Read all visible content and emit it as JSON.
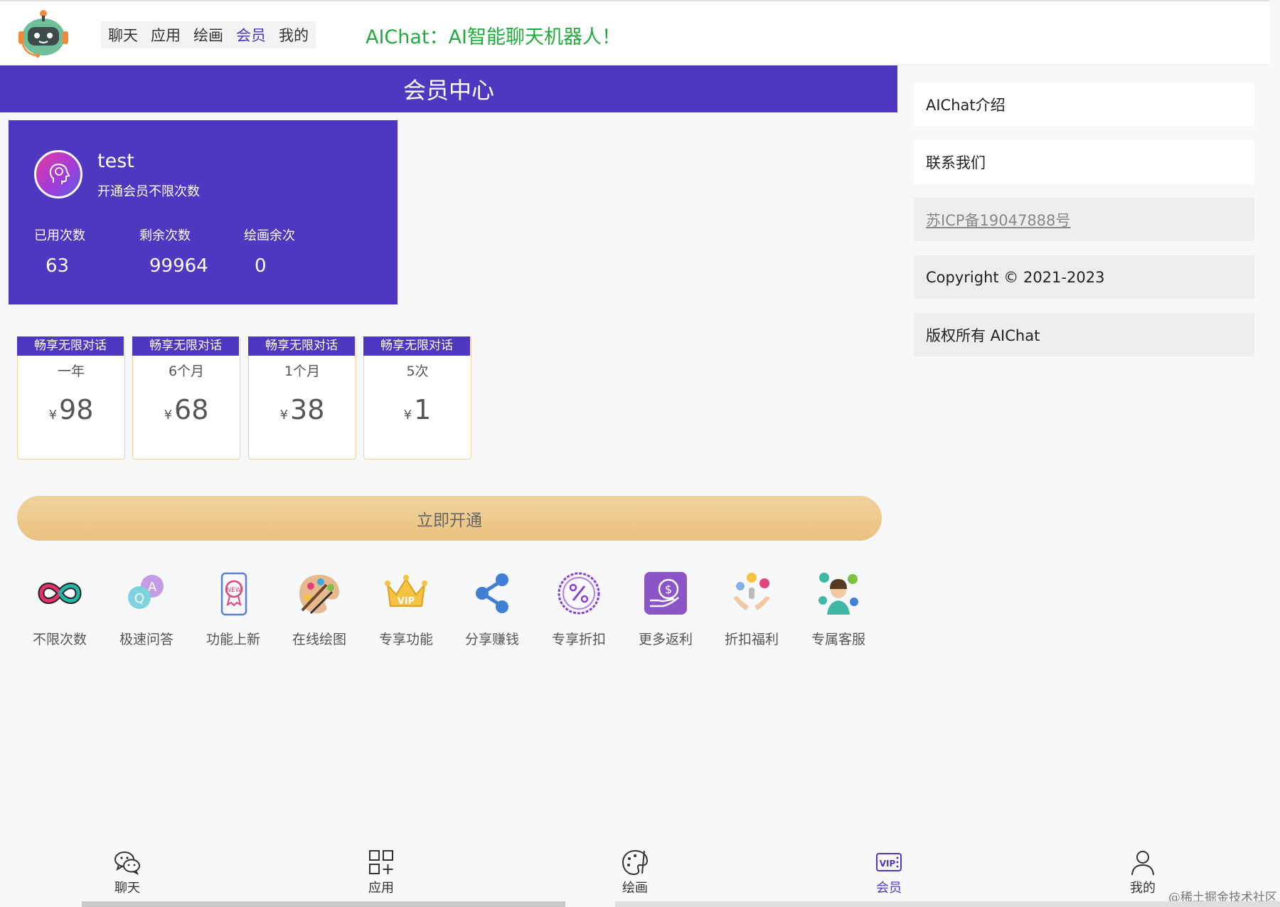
{
  "header": {
    "nav": [
      "聊天",
      "应用",
      "绘画",
      "会员",
      "我的"
    ],
    "active_nav": "会员",
    "title": "AIChat：AI智能聊天机器人！"
  },
  "page_title": "会员中心",
  "user": {
    "name": "test",
    "subtitle": "开通会员不限次数",
    "stats": [
      {
        "label": "已用次数",
        "value": "63"
      },
      {
        "label": "剩余次数",
        "value": "99964"
      },
      {
        "label": "绘画余次",
        "value": "0"
      }
    ]
  },
  "plans": [
    {
      "tag": "畅享无限对话",
      "period": "一年",
      "currency": "¥",
      "price": "98"
    },
    {
      "tag": "畅享无限对话",
      "period": "6个月",
      "currency": "¥",
      "price": "68"
    },
    {
      "tag": "畅享无限对话",
      "period": "1个月",
      "currency": "¥",
      "price": "38"
    },
    {
      "tag": "畅享无限对话",
      "period": "5次",
      "currency": "¥",
      "price": "1"
    }
  ],
  "open_button": "立即开通",
  "features": [
    {
      "label": "不限次数",
      "icon": "infinity-icon"
    },
    {
      "label": "极速问答",
      "icon": "qa-bubbles-icon"
    },
    {
      "label": "功能上新",
      "icon": "new-badge-phone-icon"
    },
    {
      "label": "在线绘图",
      "icon": "palette-icon"
    },
    {
      "label": "专享功能",
      "icon": "vip-crown-icon"
    },
    {
      "label": "分享赚钱",
      "icon": "share-icon"
    },
    {
      "label": "专享折扣",
      "icon": "percent-badge-icon"
    },
    {
      "label": "更多返利",
      "icon": "money-hand-icon"
    },
    {
      "label": "折扣福利",
      "icon": "welfare-hands-icon"
    },
    {
      "label": "专属客服",
      "icon": "customer-service-icon"
    }
  ],
  "sidebar": [
    {
      "label": "AIChat介绍"
    },
    {
      "label": "联系我们"
    },
    {
      "label": "苏ICP备19047888号"
    },
    {
      "label": "Copyright © 2021-2023"
    },
    {
      "label": "版权所有 AIChat"
    }
  ],
  "bottom_nav": [
    {
      "label": "聊天",
      "icon": "wechat-icon"
    },
    {
      "label": "应用",
      "icon": "apps-grid-icon"
    },
    {
      "label": "绘画",
      "icon": "palette-brush-icon"
    },
    {
      "label": "会员",
      "icon": "vip-icon"
    },
    {
      "label": "我的",
      "icon": "user-icon"
    }
  ],
  "watermark": "@稀土掘金技术社区",
  "colors": {
    "primary": "#4f37c1",
    "gold": "#ecc88a",
    "header_title": "#22aa3e"
  }
}
